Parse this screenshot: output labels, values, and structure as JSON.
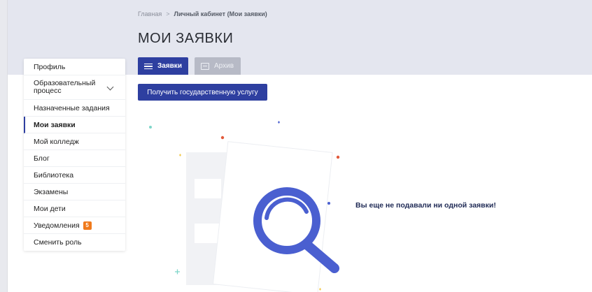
{
  "breadcrumb": {
    "home": "Главная",
    "separator": ">",
    "current": "Личный кабинет (Мои заявки)"
  },
  "page": {
    "title": "МОИ ЗАЯВКИ"
  },
  "tabs": [
    {
      "label": "Заявки",
      "icon": "list-icon",
      "active": true
    },
    {
      "label": "Архив",
      "icon": "archive-icon",
      "active": false
    }
  ],
  "actions": {
    "get_service_label": "Получить государственную услугу"
  },
  "sidebar": {
    "items": [
      {
        "label": "Профиль"
      },
      {
        "label": "Образовательный процесс",
        "expandable": true
      },
      {
        "label": "Назначенные задания"
      },
      {
        "label": "Мои заявки",
        "active": true
      },
      {
        "label": "Мой колледж"
      },
      {
        "label": "Блог"
      },
      {
        "label": "Библиотека"
      },
      {
        "label": "Экзамены"
      },
      {
        "label": "Мои дети"
      },
      {
        "label": "Уведомления",
        "badge": "5"
      },
      {
        "label": "Сменить роль"
      }
    ]
  },
  "empty_state": {
    "message": "Вы еще не подавали ни одной заявки!",
    "icon": "magnifier-illustration"
  },
  "colors": {
    "primary": "#2e3fa0",
    "tab_inactive": "#b7bac6",
    "header_band": "#e4e6ef",
    "badge": "#f07a1c",
    "magnifier": "#4a5fd0"
  }
}
